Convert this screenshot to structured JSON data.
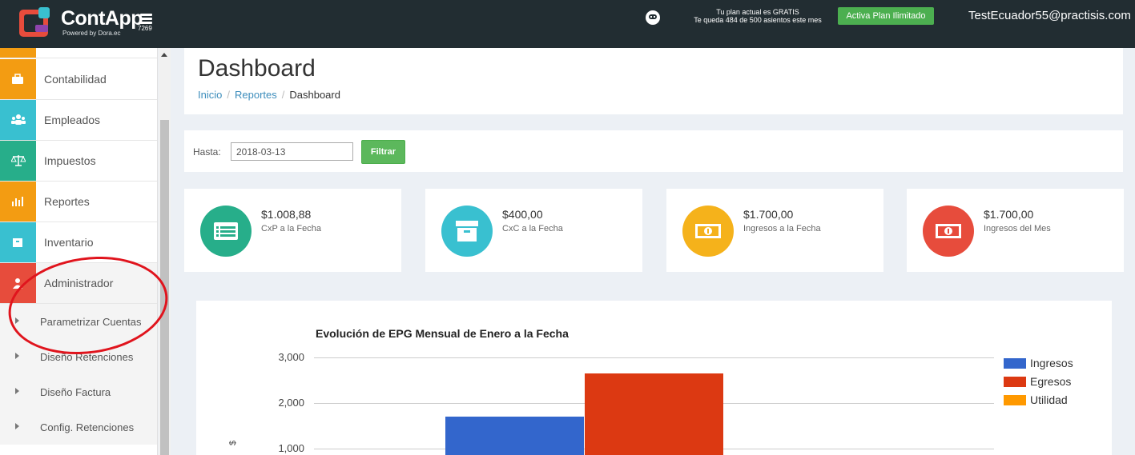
{
  "topbar": {
    "logo_text": "ContApp",
    "logo_sub": "Powered by Dora.ec",
    "menu_number": "7269",
    "plan_line1": "Tu plan actual es GRATIS",
    "plan_line2": "Te queda 484 de 500 asientos este mes",
    "plan_button": "Activa Plan Ilimitado",
    "user_email": "TestEcuador55@practisis.com",
    "colors": {
      "bar": "#222d32",
      "plan_button": "#4caf50"
    }
  },
  "sidebar": {
    "items": [
      {
        "label": "Contabilidad",
        "icon": "briefcase-icon",
        "color": "#f39c12"
      },
      {
        "label": "Empleados",
        "icon": "users-icon",
        "color": "#39c0d0"
      },
      {
        "label": "Impuestos",
        "icon": "balance-scale-icon",
        "color": "#27ae8a"
      },
      {
        "label": "Reportes",
        "icon": "bar-chart-icon",
        "color": "#f39c12"
      },
      {
        "label": "Inventario",
        "icon": "archive-icon",
        "color": "#39c0d0"
      },
      {
        "label": "Administrador",
        "icon": "user-icon",
        "color": "#e74c3c"
      }
    ],
    "subitems": [
      {
        "label": "Parametrizar Cuentas"
      },
      {
        "label": "Diseño Retenciones"
      },
      {
        "label": "Diseño Factura"
      },
      {
        "label": "Config. Retenciones"
      }
    ]
  },
  "header": {
    "title": "Dashboard",
    "breadcrumb": [
      "Inicio",
      "Reportes",
      "Dashboard"
    ]
  },
  "filter": {
    "label": "Hasta:",
    "date_value": "2018-03-13",
    "button": "Filtrar"
  },
  "stats": [
    {
      "value": "$1.008,88",
      "label": "CxP a la Fecha",
      "icon": "list-card-icon",
      "color": "#27ae8a"
    },
    {
      "value": "$400,00",
      "label": "CxC a la Fecha",
      "icon": "archive-icon",
      "color": "#39c0d0"
    },
    {
      "value": "$1.700,00",
      "label": "Ingresos a la Fecha",
      "icon": "money-bill-icon",
      "color": "#f5b21b"
    },
    {
      "value": "$1.700,00",
      "label": "Ingresos del Mes",
      "icon": "money-bill-icon",
      "color": "#e74c3c"
    }
  ],
  "chart_data": {
    "type": "bar",
    "title": "Evolución de EPG Mensual de Enero a la Fecha",
    "ylabel": "$",
    "yticks": [
      "3,000",
      "2,000",
      "1,000"
    ],
    "tick_values": [
      3000,
      2000,
      1000
    ],
    "series": [
      {
        "name": "Ingresos",
        "color": "#3366cc",
        "values": [
          1700
        ]
      },
      {
        "name": "Egresos",
        "color": "#dc3912",
        "values": [
          2650
        ]
      },
      {
        "name": "Utilidad",
        "color": "#ff9900",
        "values": [
          null
        ]
      }
    ]
  }
}
